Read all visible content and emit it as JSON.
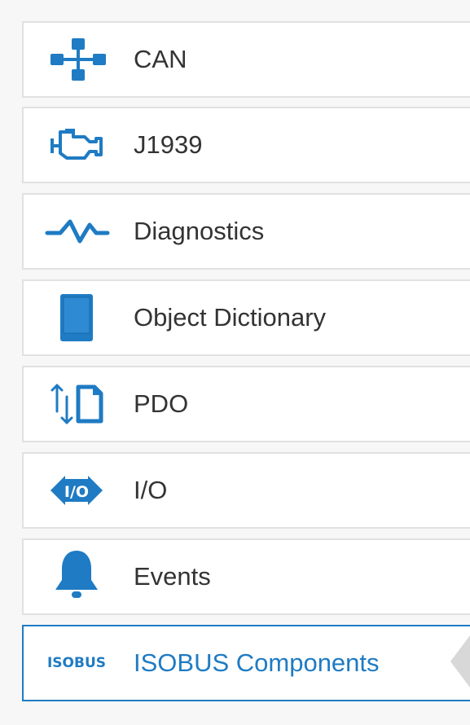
{
  "nav": {
    "items": [
      {
        "label": "CAN",
        "icon": "network-icon"
      },
      {
        "label": "J1939",
        "icon": "engine-icon"
      },
      {
        "label": "Diagnostics",
        "icon": "pulse-icon"
      },
      {
        "label": "Object Dictionary",
        "icon": "book-icon"
      },
      {
        "label": "PDO",
        "icon": "transfer-document-icon"
      },
      {
        "label": "I/O",
        "icon": "io-icon"
      },
      {
        "label": "Events",
        "icon": "bell-icon"
      },
      {
        "label": "ISOBUS Components",
        "icon": "isobus-icon",
        "icon_text": "ISOBUS",
        "active": true
      }
    ]
  },
  "colors": {
    "accent": "#1f7bc3",
    "text": "#333333",
    "border": "#e1e1e1",
    "background": "#f7f7f7"
  }
}
